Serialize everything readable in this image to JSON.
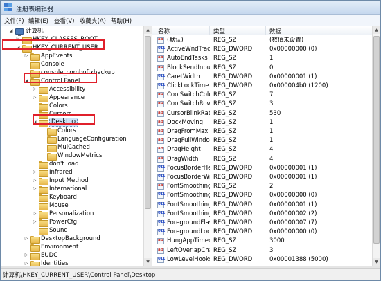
{
  "window": {
    "title": "注册表编辑器"
  },
  "menu": [
    "文件(F)",
    "编辑(E)",
    "查看(V)",
    "收藏夹(A)",
    "帮助(H)"
  ],
  "tree": {
    "root": "计算机",
    "items": [
      {
        "label": "HKEY_CLASSES_ROOT",
        "expander": "▷",
        "highlight": false,
        "selected": false
      },
      {
        "label": "HKEY_CURRENT_USER",
        "expander": "◢",
        "highlight": true,
        "selected": false
      },
      {
        "label": "AppEvents",
        "expander": "▷",
        "highlight": false,
        "selected": false
      },
      {
        "label": "Console",
        "expander": "",
        "highlight": false,
        "selected": false
      },
      {
        "label": "console_combofixbackup",
        "expander": "",
        "highlight": false,
        "selected": false
      },
      {
        "label": "Control Panel",
        "expander": "◢",
        "highlight": true,
        "selected": false
      },
      {
        "label": "Accessibility",
        "expander": "▷",
        "highlight": false,
        "selected": false
      },
      {
        "label": "Appearance",
        "expander": "▷",
        "highlight": false,
        "selected": false
      },
      {
        "label": "Colors",
        "expander": "",
        "highlight": false,
        "selected": false
      },
      {
        "label": "Cursors",
        "expander": "",
        "highlight": false,
        "selected": false
      },
      {
        "label": "Desktop",
        "expander": "◢",
        "highlight": true,
        "selected": true
      },
      {
        "label": "Colors",
        "expander": "",
        "highlight": false,
        "selected": false
      },
      {
        "label": "LanguageConfiguration",
        "expander": "",
        "highlight": false,
        "selected": false
      },
      {
        "label": "MuiCached",
        "expander": "",
        "highlight": false,
        "selected": false
      },
      {
        "label": "WindowMetrics",
        "expander": "",
        "highlight": false,
        "selected": false
      },
      {
        "label": "don't load",
        "expander": "",
        "highlight": false,
        "selected": false
      },
      {
        "label": "Infrared",
        "expander": "▷",
        "highlight": false,
        "selected": false
      },
      {
        "label": "Input Method",
        "expander": "▷",
        "highlight": false,
        "selected": false
      },
      {
        "label": "International",
        "expander": "▷",
        "highlight": false,
        "selected": false
      },
      {
        "label": "Keyboard",
        "expander": "",
        "highlight": false,
        "selected": false
      },
      {
        "label": "Mouse",
        "expander": "",
        "highlight": false,
        "selected": false
      },
      {
        "label": "Personalization",
        "expander": "▷",
        "highlight": false,
        "selected": false
      },
      {
        "label": "PowerCfg",
        "expander": "▷",
        "highlight": false,
        "selected": false
      },
      {
        "label": "Sound",
        "expander": "",
        "highlight": false,
        "selected": false
      },
      {
        "label": "DesktopBackground",
        "expander": "▷",
        "highlight": false,
        "selected": false
      },
      {
        "label": "Environment",
        "expander": "",
        "highlight": false,
        "selected": false
      },
      {
        "label": "EUDC",
        "expander": "▷",
        "highlight": false,
        "selected": false
      },
      {
        "label": "Identities",
        "expander": "▷",
        "highlight": false,
        "selected": false
      }
    ]
  },
  "list": {
    "headers": {
      "name": "名称",
      "type": "类型",
      "data": "数据"
    },
    "rows": [
      {
        "icon": "sz",
        "name": "(默认)",
        "type": "REG_SZ",
        "data": "(数值未设置)"
      },
      {
        "icon": "dword",
        "name": "ActiveWndTrack...",
        "type": "REG_DWORD",
        "data": "0x00000000 (0)"
      },
      {
        "icon": "sz",
        "name": "AutoEndTasks",
        "type": "REG_SZ",
        "data": "1"
      },
      {
        "icon": "sz",
        "name": "BlockSendInput...",
        "type": "REG_SZ",
        "data": "0"
      },
      {
        "icon": "dword",
        "name": "CaretWidth",
        "type": "REG_DWORD",
        "data": "0x00000001 (1)"
      },
      {
        "icon": "dword",
        "name": "ClickLockTime",
        "type": "REG_DWORD",
        "data": "0x000004b0 (1200)"
      },
      {
        "icon": "sz",
        "name": "CoolSwitchColu...",
        "type": "REG_SZ",
        "data": "7"
      },
      {
        "icon": "sz",
        "name": "CoolSwitchRows",
        "type": "REG_SZ",
        "data": "3"
      },
      {
        "icon": "sz",
        "name": "CursorBlinkRate",
        "type": "REG_SZ",
        "data": "530"
      },
      {
        "icon": "sz",
        "name": "DockMoving",
        "type": "REG_SZ",
        "data": "1"
      },
      {
        "icon": "sz",
        "name": "DragFromMaxi...",
        "type": "REG_SZ",
        "data": "1"
      },
      {
        "icon": "sz",
        "name": "DragFullWindows",
        "type": "REG_SZ",
        "data": "1"
      },
      {
        "icon": "sz",
        "name": "DragHeight",
        "type": "REG_SZ",
        "data": "4"
      },
      {
        "icon": "sz",
        "name": "DragWidth",
        "type": "REG_SZ",
        "data": "4"
      },
      {
        "icon": "dword",
        "name": "FocusBorderHei...",
        "type": "REG_DWORD",
        "data": "0x00000001 (1)"
      },
      {
        "icon": "dword",
        "name": "FocusBorderWid...",
        "type": "REG_DWORD",
        "data": "0x00000001 (1)"
      },
      {
        "icon": "sz",
        "name": "FontSmoothing",
        "type": "REG_SZ",
        "data": "2"
      },
      {
        "icon": "dword",
        "name": "FontSmoothing...",
        "type": "REG_DWORD",
        "data": "0x00000000 (0)"
      },
      {
        "icon": "dword",
        "name": "FontSmoothing...",
        "type": "REG_DWORD",
        "data": "0x00000001 (1)"
      },
      {
        "icon": "dword",
        "name": "FontSmoothing...",
        "type": "REG_DWORD",
        "data": "0x00000002 (2)"
      },
      {
        "icon": "dword",
        "name": "ForegroundFlas...",
        "type": "REG_DWORD",
        "data": "0x00000007 (7)"
      },
      {
        "icon": "dword",
        "name": "ForegroundLock...",
        "type": "REG_DWORD",
        "data": "0x00000000 (0)"
      },
      {
        "icon": "sz",
        "name": "HungAppTimeo...",
        "type": "REG_SZ",
        "data": "3000"
      },
      {
        "icon": "sz",
        "name": "LeftOverlapChars",
        "type": "REG_SZ",
        "data": "3"
      },
      {
        "icon": "dword",
        "name": "LowLevelHooks...",
        "type": "REG_DWORD",
        "data": "0x00001388 (5000)"
      }
    ]
  },
  "status": {
    "path": "计算机\\HKEY_CURRENT_USER\\Control Panel\\Desktop"
  },
  "icons": {
    "sz": "ab",
    "dword": "011"
  },
  "colors": {
    "highlight_box": "#e0202b",
    "selection": "#cde4f7"
  }
}
